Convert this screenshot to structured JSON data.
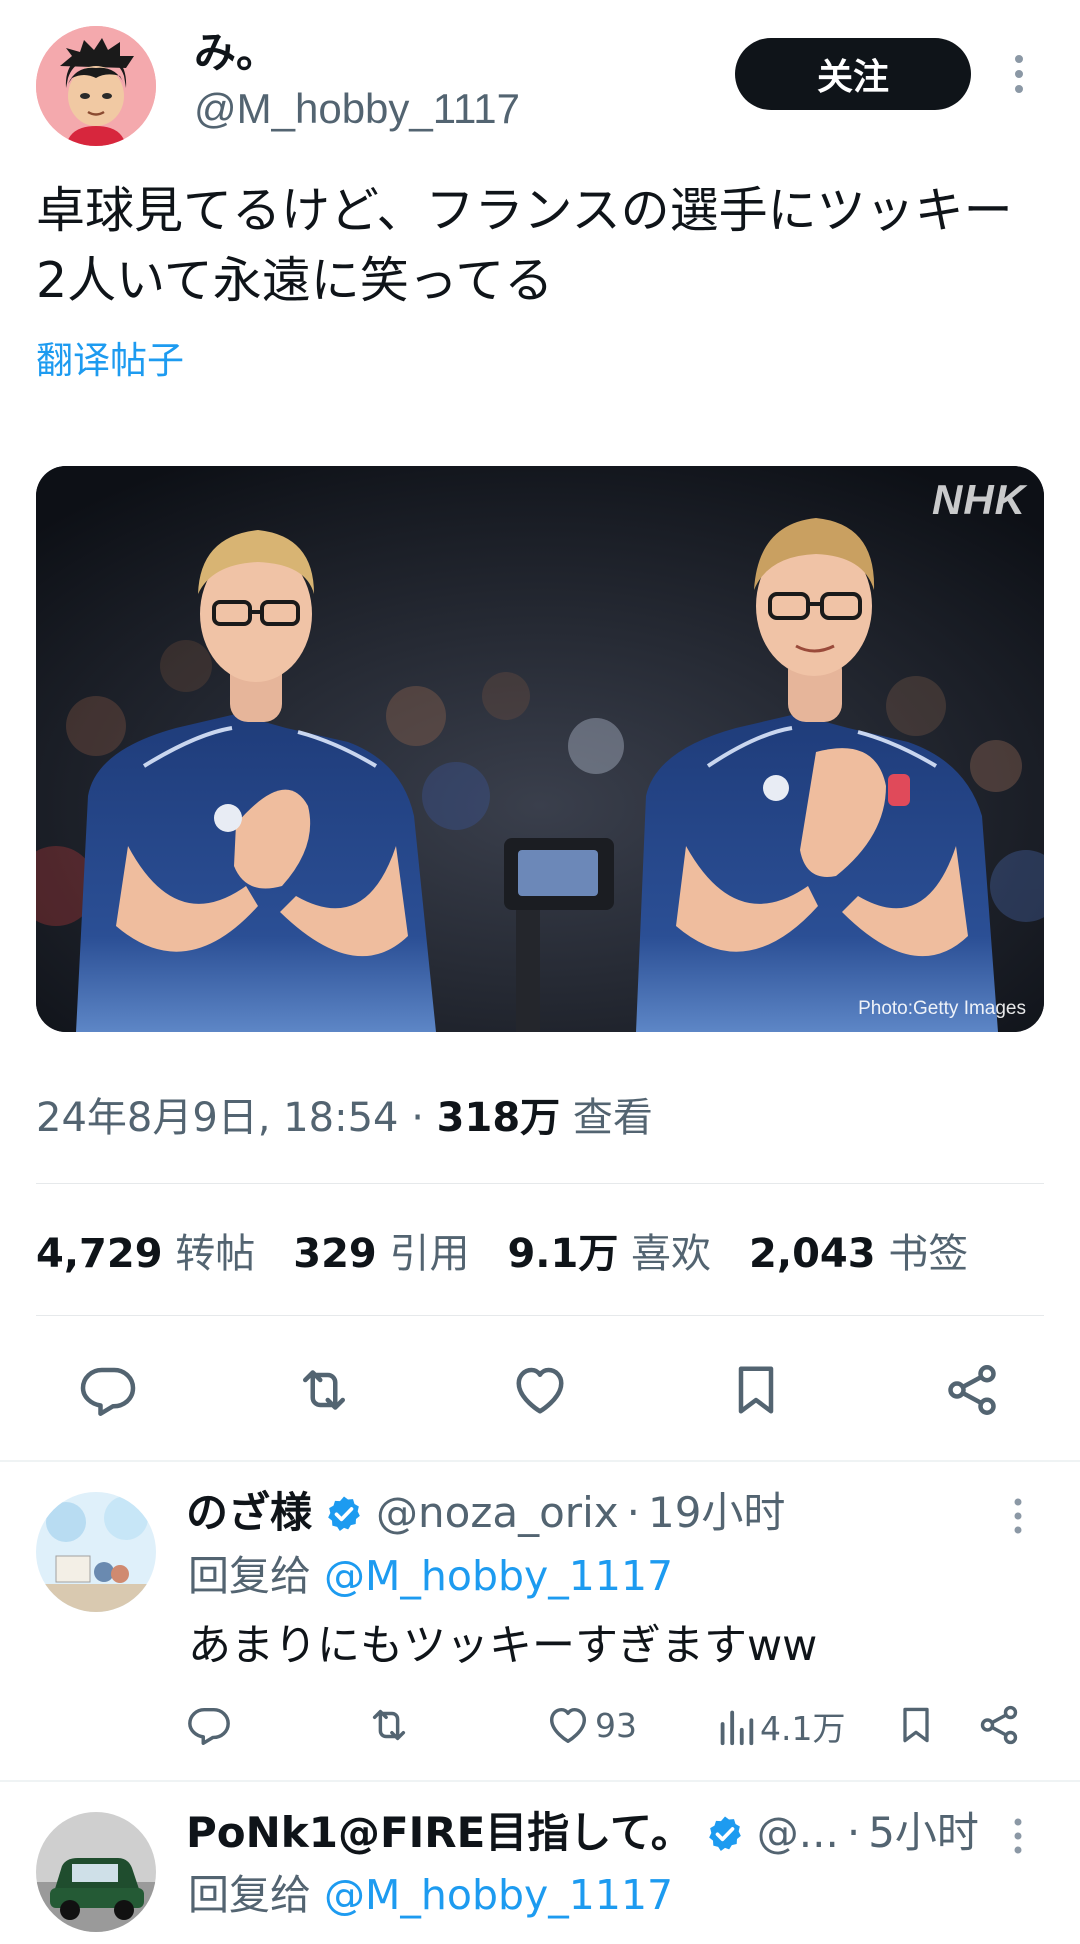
{
  "post": {
    "author": {
      "display_name": "み。",
      "handle": "@M_hobby_1117"
    },
    "follow_label": "关注",
    "text": "卓球見てるけど、フランスの選手にツッキー2人いて永遠に笑ってる",
    "translate_label": "翻译帖子",
    "media": {
      "watermark": "NHK",
      "credit": "Photo:Getty Images"
    },
    "meta": {
      "datetime": "24年8月9日, 18:54",
      "separator": " · ",
      "views_count": "318万",
      "views_label": "查看"
    },
    "stats": [
      {
        "count": "4,729",
        "label": "转帖"
      },
      {
        "count": "329",
        "label": "引用"
      },
      {
        "count": "9.1万",
        "label": "喜欢"
      },
      {
        "count": "2,043",
        "label": "书签"
      }
    ],
    "actions": [
      "reply-icon",
      "repost-icon",
      "like-icon",
      "bookmark-icon",
      "share-icon"
    ]
  },
  "replies": [
    {
      "display_name": "のざ様",
      "verified": true,
      "handle": "@noza_orix",
      "separator": "·",
      "time": "19小时",
      "reply_to_label": "回复给",
      "reply_to_handle": "@M_hobby_1117",
      "text": "あまりにもツッキーすぎますww",
      "likes": "93",
      "views": "4.1万"
    },
    {
      "display_name": "PoNk1@FIRE目指して。",
      "verified": true,
      "handle": "@...",
      "separator": "·",
      "time": "5小时",
      "reply_to_label": "回复给",
      "reply_to_handle": "@M_hobby_1117"
    }
  ],
  "colors": {
    "accent": "#1d9bf0",
    "text": "#0f1419",
    "secondary": "#536471",
    "follow_bg": "#0f1419"
  }
}
